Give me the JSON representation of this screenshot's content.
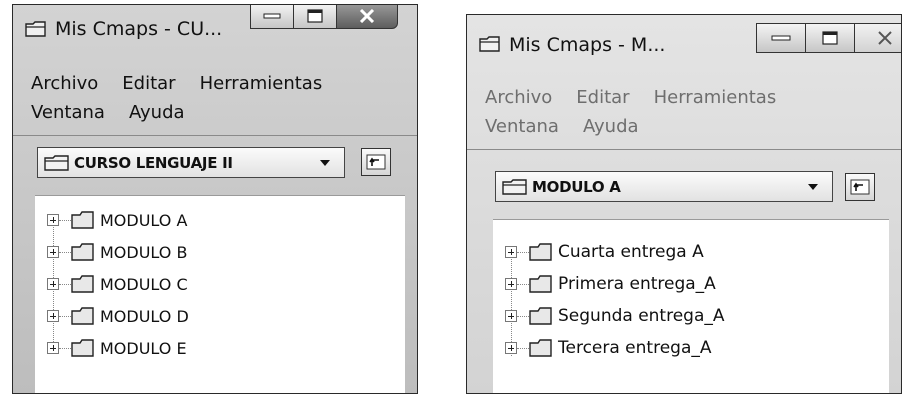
{
  "windows": [
    {
      "title": "Mis Cmaps - CU...",
      "menu_rows": [
        [
          "Archivo",
          "Editar",
          "Herramientas"
        ],
        [
          "Ventana",
          "Ayuda"
        ]
      ],
      "folder_selector": {
        "value": "CURSO LENGUAJE II"
      },
      "tree_items": [
        "MODULO A",
        "MODULO B",
        "MODULO C",
        "MODULO D",
        "MODULO E"
      ]
    },
    {
      "title": "Mis Cmaps - M...",
      "menu_rows": [
        [
          "Archivo",
          "Editar",
          "Herramientas"
        ],
        [
          "Ventana",
          "Ayuda"
        ]
      ],
      "folder_selector": {
        "value": "MODULO A"
      },
      "tree_items": [
        "Cuarta entrega A",
        "Primera entrega_A",
        "Segunda entrega_A",
        "Tercera entrega_A"
      ]
    }
  ],
  "icons": {
    "app": "folder-icon",
    "minimize": "minimize-icon",
    "maximize": "maximize-icon",
    "close": "close-icon",
    "dropdown": "chevron-down-icon",
    "up_folder": "folder-up-icon",
    "expand": "plus-expander-icon"
  }
}
